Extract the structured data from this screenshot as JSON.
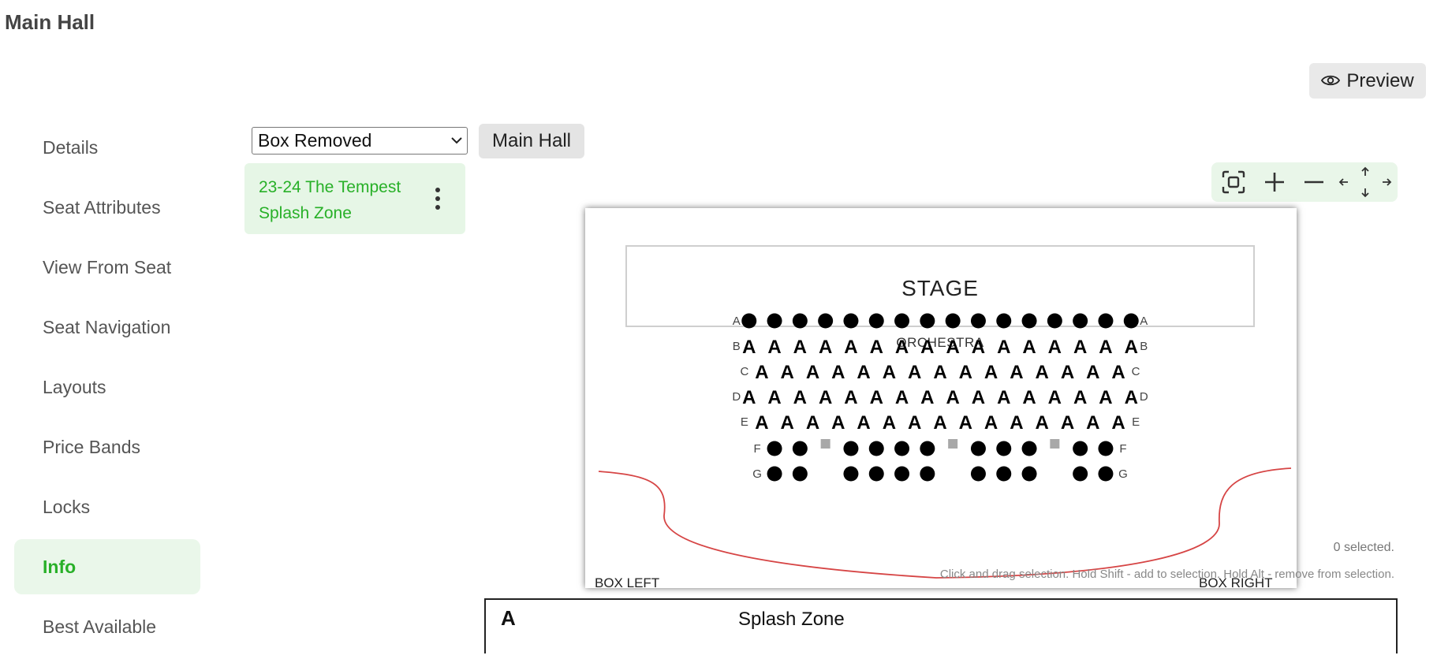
{
  "page_title": "Main Hall",
  "preview_label": "Preview",
  "sidebar": {
    "items": [
      {
        "label": "Details",
        "active": false
      },
      {
        "label": "Seat Attributes",
        "active": false
      },
      {
        "label": "View From Seat",
        "active": false
      },
      {
        "label": "Seat Navigation",
        "active": false
      },
      {
        "label": "Layouts",
        "active": false
      },
      {
        "label": "Price Bands",
        "active": false
      },
      {
        "label": "Locks",
        "active": false
      },
      {
        "label": "Info",
        "active": true
      },
      {
        "label": "Best Available",
        "active": false
      }
    ]
  },
  "toolbar": {
    "select_value": "Box Removed",
    "hall_button": "Main Hall"
  },
  "layout_card": {
    "name": "23-24 The Tempest Splash Zone"
  },
  "zoom_controls": [
    "fit-screen-icon",
    "zoom-in-icon",
    "zoom-out-icon",
    "pan-icon"
  ],
  "seat_map": {
    "stage_label": "STAGE",
    "section_label": "ORCHESTRA",
    "box_left_label": "BOX LEFT",
    "box_right_label": "BOX RIGHT",
    "info_glyph": "A",
    "rows": [
      {
        "label": "A",
        "seats": "OOOOOOOOOOOOOOOO"
      },
      {
        "label": "B",
        "seats": "AAAAAAAAAAAAAAAA"
      },
      {
        "label": "C",
        "seats": "AAAAAAAAAAAAAAA"
      },
      {
        "label": "D",
        "seats": "AAAAAAAAAAAAAAAA"
      },
      {
        "label": "E",
        "seats": "AAAAAAAAAAAAAAA"
      },
      {
        "label": "F",
        "seats": "OOxOOOOxOOOxOO"
      },
      {
        "label": "G",
        "seats": "OO_OOOO_OOO_OO"
      }
    ],
    "colors": {
      "seat": "#000000",
      "placeholder": "#a8a8a8",
      "curve": "#d64545",
      "stage_border": "#cccccc"
    }
  },
  "selection_status": "0 selected.",
  "selection_hint": "Click and drag selection. Hold Shift - add to selection. Hold Alt - remove from selection.",
  "info_panel": {
    "glyph": "A",
    "name": "Splash Zone"
  },
  "colors": {
    "accent": "#28b028",
    "accent_bg": "#eaf7ea"
  }
}
